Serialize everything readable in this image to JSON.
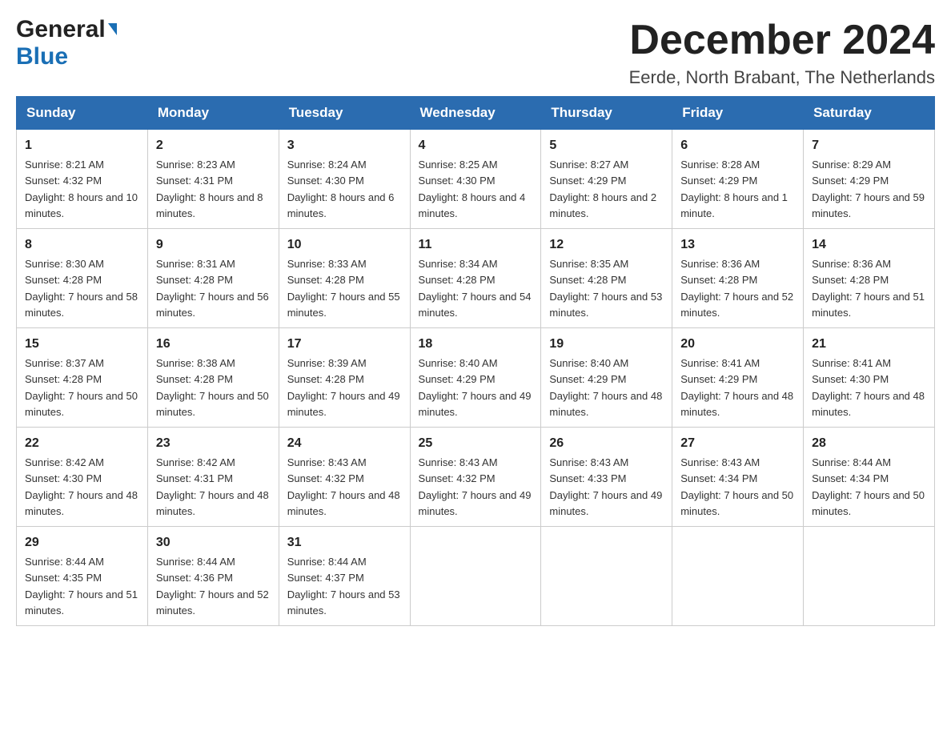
{
  "header": {
    "logo_general": "General",
    "logo_blue": "Blue",
    "month_title": "December 2024",
    "location": "Eerde, North Brabant, The Netherlands"
  },
  "days_of_week": [
    "Sunday",
    "Monday",
    "Tuesday",
    "Wednesday",
    "Thursday",
    "Friday",
    "Saturday"
  ],
  "weeks": [
    [
      {
        "date": "1",
        "sunrise": "8:21 AM",
        "sunset": "4:32 PM",
        "daylight": "8 hours and 10 minutes."
      },
      {
        "date": "2",
        "sunrise": "8:23 AM",
        "sunset": "4:31 PM",
        "daylight": "8 hours and 8 minutes."
      },
      {
        "date": "3",
        "sunrise": "8:24 AM",
        "sunset": "4:30 PM",
        "daylight": "8 hours and 6 minutes."
      },
      {
        "date": "4",
        "sunrise": "8:25 AM",
        "sunset": "4:30 PM",
        "daylight": "8 hours and 4 minutes."
      },
      {
        "date": "5",
        "sunrise": "8:27 AM",
        "sunset": "4:29 PM",
        "daylight": "8 hours and 2 minutes."
      },
      {
        "date": "6",
        "sunrise": "8:28 AM",
        "sunset": "4:29 PM",
        "daylight": "8 hours and 1 minute."
      },
      {
        "date": "7",
        "sunrise": "8:29 AM",
        "sunset": "4:29 PM",
        "daylight": "7 hours and 59 minutes."
      }
    ],
    [
      {
        "date": "8",
        "sunrise": "8:30 AM",
        "sunset": "4:28 PM",
        "daylight": "7 hours and 58 minutes."
      },
      {
        "date": "9",
        "sunrise": "8:31 AM",
        "sunset": "4:28 PM",
        "daylight": "7 hours and 56 minutes."
      },
      {
        "date": "10",
        "sunrise": "8:33 AM",
        "sunset": "4:28 PM",
        "daylight": "7 hours and 55 minutes."
      },
      {
        "date": "11",
        "sunrise": "8:34 AM",
        "sunset": "4:28 PM",
        "daylight": "7 hours and 54 minutes."
      },
      {
        "date": "12",
        "sunrise": "8:35 AM",
        "sunset": "4:28 PM",
        "daylight": "7 hours and 53 minutes."
      },
      {
        "date": "13",
        "sunrise": "8:36 AM",
        "sunset": "4:28 PM",
        "daylight": "7 hours and 52 minutes."
      },
      {
        "date": "14",
        "sunrise": "8:36 AM",
        "sunset": "4:28 PM",
        "daylight": "7 hours and 51 minutes."
      }
    ],
    [
      {
        "date": "15",
        "sunrise": "8:37 AM",
        "sunset": "4:28 PM",
        "daylight": "7 hours and 50 minutes."
      },
      {
        "date": "16",
        "sunrise": "8:38 AM",
        "sunset": "4:28 PM",
        "daylight": "7 hours and 50 minutes."
      },
      {
        "date": "17",
        "sunrise": "8:39 AM",
        "sunset": "4:28 PM",
        "daylight": "7 hours and 49 minutes."
      },
      {
        "date": "18",
        "sunrise": "8:40 AM",
        "sunset": "4:29 PM",
        "daylight": "7 hours and 49 minutes."
      },
      {
        "date": "19",
        "sunrise": "8:40 AM",
        "sunset": "4:29 PM",
        "daylight": "7 hours and 48 minutes."
      },
      {
        "date": "20",
        "sunrise": "8:41 AM",
        "sunset": "4:29 PM",
        "daylight": "7 hours and 48 minutes."
      },
      {
        "date": "21",
        "sunrise": "8:41 AM",
        "sunset": "4:30 PM",
        "daylight": "7 hours and 48 minutes."
      }
    ],
    [
      {
        "date": "22",
        "sunrise": "8:42 AM",
        "sunset": "4:30 PM",
        "daylight": "7 hours and 48 minutes."
      },
      {
        "date": "23",
        "sunrise": "8:42 AM",
        "sunset": "4:31 PM",
        "daylight": "7 hours and 48 minutes."
      },
      {
        "date": "24",
        "sunrise": "8:43 AM",
        "sunset": "4:32 PM",
        "daylight": "7 hours and 48 minutes."
      },
      {
        "date": "25",
        "sunrise": "8:43 AM",
        "sunset": "4:32 PM",
        "daylight": "7 hours and 49 minutes."
      },
      {
        "date": "26",
        "sunrise": "8:43 AM",
        "sunset": "4:33 PM",
        "daylight": "7 hours and 49 minutes."
      },
      {
        "date": "27",
        "sunrise": "8:43 AM",
        "sunset": "4:34 PM",
        "daylight": "7 hours and 50 minutes."
      },
      {
        "date": "28",
        "sunrise": "8:44 AM",
        "sunset": "4:34 PM",
        "daylight": "7 hours and 50 minutes."
      }
    ],
    [
      {
        "date": "29",
        "sunrise": "8:44 AM",
        "sunset": "4:35 PM",
        "daylight": "7 hours and 51 minutes."
      },
      {
        "date": "30",
        "sunrise": "8:44 AM",
        "sunset": "4:36 PM",
        "daylight": "7 hours and 52 minutes."
      },
      {
        "date": "31",
        "sunrise": "8:44 AM",
        "sunset": "4:37 PM",
        "daylight": "7 hours and 53 minutes."
      },
      null,
      null,
      null,
      null
    ]
  ],
  "sunrise_label": "Sunrise:",
  "sunset_label": "Sunset:",
  "daylight_label": "Daylight:"
}
